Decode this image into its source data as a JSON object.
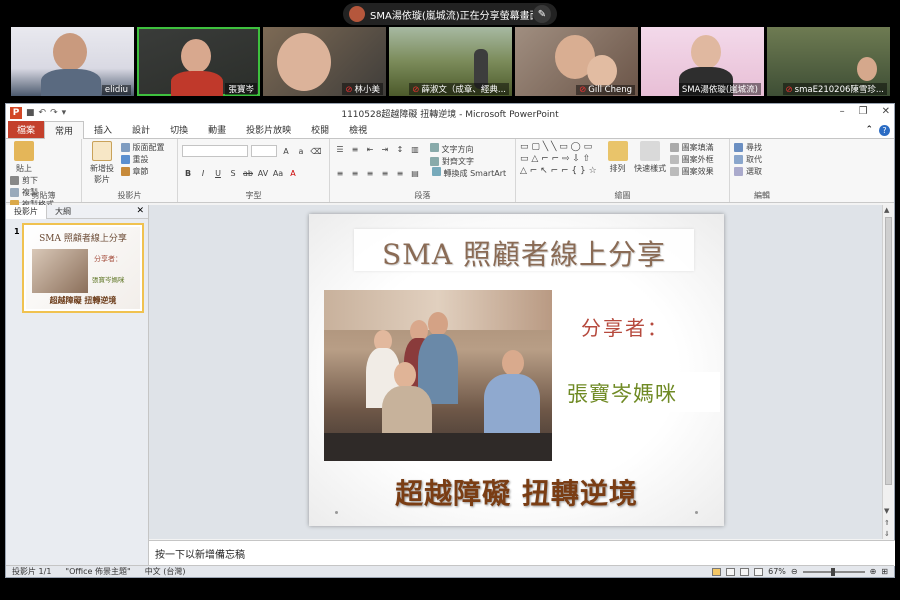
{
  "zoom": {
    "share_banner": "SMA湯依璇(嵐城流)正在分享螢幕畫面。",
    "participants": [
      {
        "name": "elidiu",
        "muted": false
      },
      {
        "name": "張寶岑",
        "muted": false,
        "active": true
      },
      {
        "name": "林小美",
        "muted": true
      },
      {
        "name": "薛淑文（成章、經典...",
        "muted": true
      },
      {
        "name": "Gill Cheng",
        "muted": true
      },
      {
        "name": "SMA湯依璇(嵐城流)",
        "muted": false
      },
      {
        "name": "smaE210206陳雪珍...",
        "muted": true
      }
    ]
  },
  "window": {
    "title": "1110528超越障礙 扭轉逆境 - Microsoft PowerPoint"
  },
  "ribbon": {
    "tabs": [
      "檔案",
      "常用",
      "插入",
      "設計",
      "切換",
      "動畫",
      "投影片放映",
      "校閱",
      "檢視"
    ],
    "active_tab": "常用",
    "clipboard": {
      "paste": "貼上",
      "cut": "剪下",
      "copy": "複製",
      "format_painter": "複製格式",
      "label": "剪貼簿"
    },
    "slides": {
      "new_slide": "新增投影片",
      "layout": "版面配置",
      "reset": "重設",
      "section": "章節",
      "label": "投影片"
    },
    "font": {
      "label": "字型"
    },
    "paragraph": {
      "text_direction": "文字方向",
      "align_text": "對齊文字",
      "smartart": "轉換成 SmartArt",
      "label": "段落"
    },
    "drawing": {
      "arrange": "排列",
      "quick_styles": "快速樣式",
      "shape_fill": "圖案填滿",
      "shape_outline": "圖案外框",
      "shape_effects": "圖案效果",
      "label": "繪圖"
    },
    "editing": {
      "find": "尋找",
      "replace": "取代",
      "select": "選取",
      "label": "編輯"
    }
  },
  "left_panel": {
    "tabs": [
      "投影片",
      "大綱"
    ],
    "slide_number": "1"
  },
  "slide": {
    "title": "SMA 照顧者線上分享",
    "share_label": "分享者：",
    "presenter": "張寶岑媽咪",
    "subtitle": "超越障礙 扭轉逆境"
  },
  "notes_placeholder": "按一下以新增備忘稿",
  "status": {
    "slide_pos": "投影片 1/1",
    "theme": "\"Office 佈景主題\"",
    "language": "中文 (台灣)",
    "zoom": "67%"
  },
  "colors": {
    "file_tab": "#c4402c",
    "active_speaker": "#3ec03e",
    "slide_title": "#8a6b55",
    "share_label": "#b64a3e",
    "presenter": "#6f8a24",
    "subtitle": "#7a3d14"
  }
}
